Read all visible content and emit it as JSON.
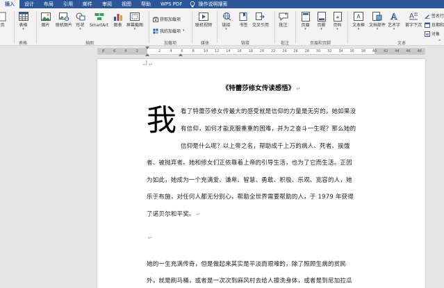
{
  "tabs": [
    "插入",
    "设计",
    "布局",
    "引用",
    "邮件",
    "审阅",
    "视图",
    "帮助",
    "WPS PDF"
  ],
  "tell_me": "操作说明搜索",
  "ribbon": {
    "items": {
      "page": "页",
      "table": "表格",
      "picture": "图片",
      "online_picture": "联机图片",
      "shapes": "形状",
      "smartart": "SmartArt",
      "chart": "图表",
      "screenshot": "屏幕截图",
      "get_addins": "获取加载项",
      "my_addins": "我的加载项",
      "online_video": "联机视频",
      "link": "链接",
      "bookmark": "书签",
      "cross_ref": "交叉引用",
      "comment": "批注",
      "header": "页眉",
      "footer": "页脚",
      "page_number": "页码",
      "textbox": "文本框",
      "quick_parts": "文档部件",
      "wordart": "艺术字",
      "dropcap": "首字下沉",
      "signature": "签名行",
      "datetime": "日期和",
      "object": "对象"
    },
    "groups": {
      "tables": "表格",
      "illustrations": "插图",
      "addins": "加载项",
      "media": "媒体",
      "links": "链接",
      "comments": "批注",
      "header_footer": "页眉和页脚",
      "text": "文本"
    }
  },
  "ruler": {
    "numbers": [
      "8",
      "6",
      "4",
      "2",
      "",
      "2",
      "4",
      "6",
      "8",
      "10",
      "12",
      "14",
      "16",
      "18",
      "20",
      "22",
      "24",
      "26",
      "28",
      "30",
      "32",
      "34",
      "36",
      "38",
      "40",
      "42",
      "44",
      "46",
      "48"
    ]
  },
  "document": {
    "title": "《特蕾莎修女传读感悟》",
    "dropcap": "我",
    "para_mark": "↵",
    "lines": [
      "看了特蕾莎修女传最大的感受就是信仰的力量是无穷的，她如果没",
      "有信仰，如何才能克服重重的困难，并为之奋斗一生呢？那么她的",
      "信仰是什么呢？以上帝之名，帮助成千上万的病人、死者、挨饿",
      "者、被抛弃者。她和修女们正依靠着上帝的引导生活，也为了它而生活。正因",
      "为如此，她成为一个充满爱、谦卑、智慧、勇敢、积极、乐观、宽容的人，她",
      "乐于布施，对任何人都无分别心，帮助全世界需要帮助的人，于 1979 年获得",
      "了诺贝尔和平奖。",
      "",
      "她的一生充满传奇，但是做起来其实是平淡而艰难的，除了照顾生病的贫民",
      "外，就是刷马桶，或者是一次次到麻风村去给人擦洗身体，或者是到尼加拉瓜"
    ]
  },
  "colors": {
    "tabbar": "#2b579a",
    "ribbon": "#f3f3f3",
    "canvas": "#e6e6e6",
    "page": "#ffffff"
  }
}
